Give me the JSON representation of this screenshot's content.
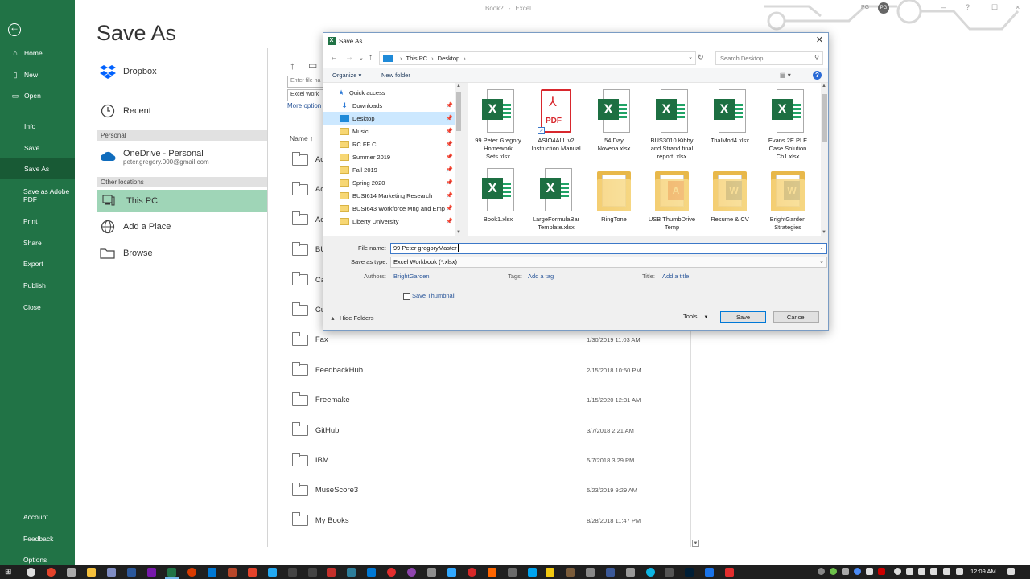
{
  "window": {
    "title_doc": "Book2",
    "title_sep": "-",
    "title_app": "Excel",
    "user_name": "PG",
    "user_initials": "PG",
    "minimize": "–",
    "maximize": "☐",
    "close": "×"
  },
  "nav": {
    "home": "Home",
    "new": "New",
    "open": "Open",
    "info": "Info",
    "save": "Save",
    "save_as": "Save As",
    "save_as_adobe": "Save as Adobe PDF",
    "print": "Print",
    "share": "Share",
    "export": "Export",
    "publish": "Publish",
    "close": "Close",
    "account": "Account",
    "feedback": "Feedback",
    "options": "Options"
  },
  "backstage": {
    "title": "Save As",
    "dropbox": "Dropbox",
    "recent": "Recent",
    "personal_header": "Personal",
    "onedrive_title": "OneDrive - Personal",
    "onedrive_email": "peter.gregory.000@gmail.com",
    "other_header": "Other locations",
    "this_pc": "This PC",
    "add_place": "Add a Place",
    "browse": "Browse",
    "filename_placeholder": "Enter file na",
    "filetype_value": "Excel Work",
    "more_options": "More option",
    "col_name": "Name ↑",
    "folders": [
      {
        "name": "Ac",
        "date": ""
      },
      {
        "name": "Ac",
        "date": ""
      },
      {
        "name": "Ac",
        "date": ""
      },
      {
        "name": "BU",
        "date": ""
      },
      {
        "name": "Ca",
        "date": ""
      },
      {
        "name": "Cu",
        "date": ""
      },
      {
        "name": "Fax",
        "date": "1/30/2019 11:03 AM"
      },
      {
        "name": "FeedbackHub",
        "date": "2/15/2018 10:50 PM"
      },
      {
        "name": "Freemake",
        "date": "1/15/2020 12:31 AM"
      },
      {
        "name": "GitHub",
        "date": "3/7/2018 2:21 AM"
      },
      {
        "name": "IBM",
        "date": "5/7/2018 3:29 PM"
      },
      {
        "name": "MuseScore3",
        "date": "5/23/2019 9:29 AM"
      },
      {
        "name": "My Books",
        "date": "8/28/2018 11:47 PM"
      }
    ]
  },
  "dialog": {
    "title": "Save As",
    "address": {
      "crumb1": "This PC",
      "crumb2": "Desktop"
    },
    "search_placeholder": "Search Desktop",
    "organize": "Organize ▾",
    "new_folder": "New folder",
    "tree": [
      {
        "label": "Quick access",
        "icon": "star",
        "pin": ""
      },
      {
        "label": "Downloads",
        "icon": "down",
        "pin": "📌"
      },
      {
        "label": "Desktop",
        "icon": "desk",
        "pin": "📌"
      },
      {
        "label": "Music",
        "icon": "fold",
        "pin": "📌"
      },
      {
        "label": "RC FF CL",
        "icon": "fold",
        "pin": "📌"
      },
      {
        "label": "Summer 2019",
        "icon": "fold",
        "pin": "📌"
      },
      {
        "label": "Fall 2019",
        "icon": "fold",
        "pin": "📌"
      },
      {
        "label": "Spring 2020",
        "icon": "fold",
        "pin": "📌"
      },
      {
        "label": "BUSI614 Marketing Research",
        "icon": "fold",
        "pin": "📌"
      },
      {
        "label": "BUSI643 Workforce Mng and Emp",
        "icon": "fold",
        "pin": "📌"
      },
      {
        "label": "Liberty University",
        "icon": "fold",
        "pin": "📌"
      }
    ],
    "files": [
      {
        "label": "99 Peter Gregory Homework Sets.xlsx",
        "type": "xlsx"
      },
      {
        "label": "ASIO4ALL v2 Instruction Manual",
        "type": "pdf"
      },
      {
        "label": "54 Day Novena.xlsx",
        "type": "xlsx"
      },
      {
        "label": "BUS3010 Kibby and Strand final report .xlsx",
        "type": "xlsx"
      },
      {
        "label": "TrialMod4.xlsx",
        "type": "xlsx"
      },
      {
        "label": "Evans 2E PLE Case Solution Ch1.xlsx",
        "type": "xlsx"
      },
      {
        "label": "Book1.xlsx",
        "type": "xlsx"
      },
      {
        "label": "LargeFormulaBar Template.xlsx",
        "type": "xlsx"
      },
      {
        "label": "RingTone",
        "type": "folder"
      },
      {
        "label": "USB ThumbDrive Temp",
        "type": "folder-pdf"
      },
      {
        "label": "Resume & CV",
        "type": "folder-word"
      },
      {
        "label": "BrightGarden Strategies",
        "type": "folder-word"
      }
    ],
    "file_name_label": "File name:",
    "file_name_value": "99 Peter gregoryMaster",
    "save_type_label": "Save as type:",
    "save_type_value": "Excel Workbook (*.xlsx)",
    "authors_label": "Authors:",
    "authors_value": "BrightGarden",
    "tags_label": "Tags:",
    "tags_value": "Add a tag",
    "title_label": "Title:",
    "title_value": "Add a title",
    "save_thumbnail": "Save Thumbnail",
    "hide_folders": "Hide Folders",
    "tools": "Tools",
    "save_button": "Save",
    "cancel_button": "Cancel"
  },
  "taskbar": {
    "time": "12:09 AM"
  },
  "colors": {
    "excel_green": "#217346",
    "selected_location": "#9fd5b7",
    "link_blue": "#2b579a"
  }
}
